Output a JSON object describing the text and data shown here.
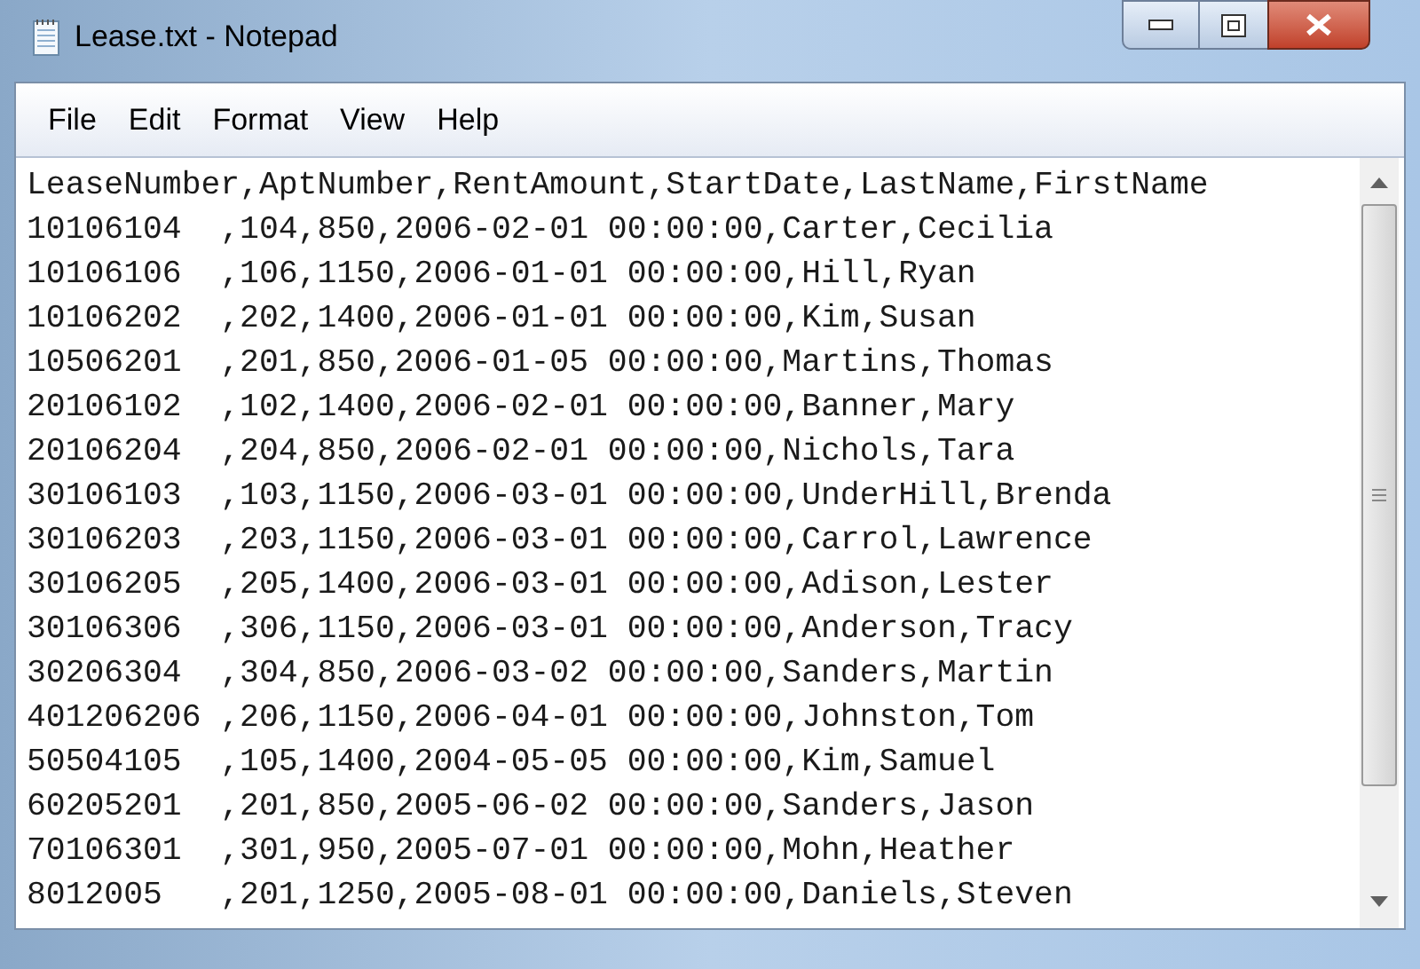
{
  "window": {
    "title": "Lease.txt - Notepad"
  },
  "menu": [
    "File",
    "Edit",
    "Format",
    "View",
    "Help"
  ],
  "lines": [
    "LeaseNumber,AptNumber,RentAmount,StartDate,LastName,FirstName",
    "10106104  ,104,850,2006-02-01 00:00:00,Carter,Cecilia",
    "10106106  ,106,1150,2006-01-01 00:00:00,Hill,Ryan",
    "10106202  ,202,1400,2006-01-01 00:00:00,Kim,Susan",
    "10506201  ,201,850,2006-01-05 00:00:00,Martins,Thomas",
    "20106102  ,102,1400,2006-02-01 00:00:00,Banner,Mary",
    "20106204  ,204,850,2006-02-01 00:00:00,Nichols,Tara",
    "30106103  ,103,1150,2006-03-01 00:00:00,UnderHill,Brenda",
    "30106203  ,203,1150,2006-03-01 00:00:00,Carrol,Lawrence",
    "30106205  ,205,1400,2006-03-01 00:00:00,Adison,Lester",
    "30106306  ,306,1150,2006-03-01 00:00:00,Anderson,Tracy",
    "30206304  ,304,850,2006-03-02 00:00:00,Sanders,Martin",
    "401206206 ,206,1150,2006-04-01 00:00:00,Johnston,Tom",
    "50504105  ,105,1400,2004-05-05 00:00:00,Kim,Samuel",
    "60205201  ,201,850,2005-06-02 00:00:00,Sanders,Jason",
    "70106301  ,301,950,2005-07-01 00:00:00,Mohn,Heather",
    "8012005   ,201,1250,2005-08-01 00:00:00,Daniels,Steven"
  ]
}
